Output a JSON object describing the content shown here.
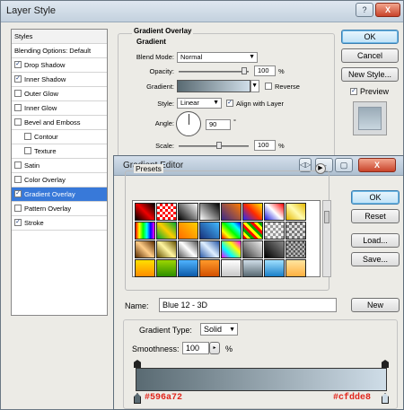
{
  "layer_style": {
    "title": "Layer Style",
    "titlebar_buttons": [
      "?",
      "X"
    ],
    "styles": [
      {
        "label": "Styles",
        "checked": null,
        "header": true
      },
      {
        "label": "Blending Options: Default",
        "checked": null
      },
      {
        "label": "Drop Shadow",
        "checked": true
      },
      {
        "label": "Inner Shadow",
        "checked": true
      },
      {
        "label": "Outer Glow",
        "checked": false
      },
      {
        "label": "Inner Glow",
        "checked": false
      },
      {
        "label": "Bevel and Emboss",
        "checked": false
      },
      {
        "label": "Contour",
        "checked": false,
        "indent": true
      },
      {
        "label": "Texture",
        "checked": false,
        "indent": true
      },
      {
        "label": "Satin",
        "checked": false
      },
      {
        "label": "Color Overlay",
        "checked": false
      },
      {
        "label": "Gradient Overlay",
        "checked": true,
        "selected": true
      },
      {
        "label": "Pattern Overlay",
        "checked": false
      },
      {
        "label": "Stroke",
        "checked": true
      }
    ],
    "buttons": {
      "ok": "OK",
      "cancel": "Cancel",
      "new_style": "New Style...",
      "preview": "Preview"
    },
    "gradient_overlay": {
      "title": "Gradient Overlay",
      "section": "Gradient",
      "blend_mode_label": "Blend Mode:",
      "blend_mode_value": "Normal",
      "opacity_label": "Opacity:",
      "opacity_value": "100",
      "opacity_unit": "%",
      "gradient_label": "Gradient:",
      "reverse_label": "Reverse",
      "style_label": "Style:",
      "style_value": "Linear",
      "align_label": "Align with Layer",
      "angle_label": "Angle:",
      "angle_value": "90",
      "angle_unit": "°",
      "scale_label": "Scale:",
      "scale_value": "100",
      "scale_unit": "%"
    }
  },
  "gradient_editor": {
    "title": "Gradient Editor",
    "presets_label": "Presets",
    "buttons": {
      "ok": "OK",
      "reset": "Reset",
      "load": "Load...",
      "save": "Save...",
      "new": "New"
    },
    "name_label": "Name:",
    "name_value": "Blue 12 - 3D",
    "gradient_type_label": "Gradient Type:",
    "gradient_type_value": "Solid",
    "smoothness_label": "Smoothness:",
    "smoothness_value": "100",
    "smoothness_unit": "%",
    "color_left": "#596a72",
    "color_right": "#cfdde8",
    "color_left_label": "#596a72",
    "color_right_label": "#cfdde8"
  }
}
